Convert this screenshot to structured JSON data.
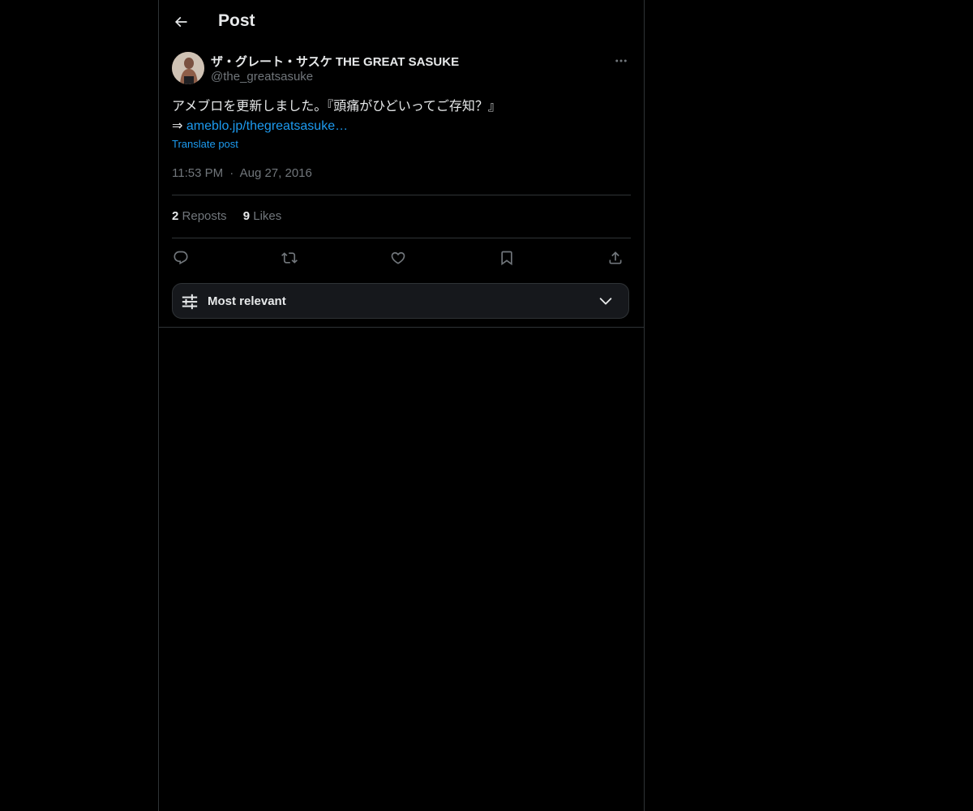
{
  "header": {
    "title": "Post",
    "back_icon": "arrow-left-icon"
  },
  "post": {
    "author": {
      "display_name": "ザ・グレート・サスケ THE GREAT SASUKE",
      "handle": "@the_greatsasuke"
    },
    "text_line1": "アメブロを更新しました。『頭痛がひどいってご存知？』",
    "text_arrow": "⇒ ",
    "link_text": "ameblo.jp/thegreatsasuke…",
    "translate_label": "Translate post",
    "time": "11:53 PM",
    "separator": "·",
    "date": "Aug 27, 2016",
    "stats": {
      "reposts_count": "2",
      "reposts_label": "Reposts",
      "likes_count": "9",
      "likes_label": "Likes"
    }
  },
  "actions": [
    "reply-icon",
    "repost-icon",
    "like-icon",
    "bookmark-icon",
    "share-icon"
  ],
  "sort": {
    "label": "Most relevant"
  },
  "colors": {
    "background": "#000000",
    "text": "#e7e9ea",
    "muted": "#71767b",
    "accent": "#1d9bf0",
    "border": "#2f3336"
  }
}
